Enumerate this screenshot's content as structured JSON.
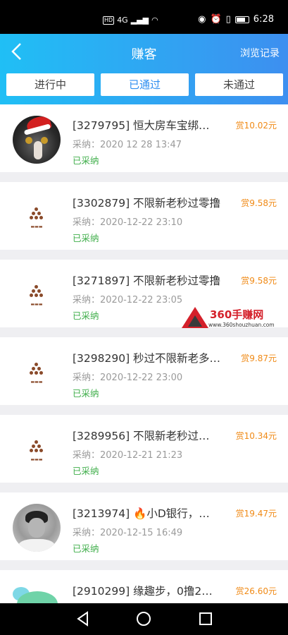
{
  "status_bar": {
    "badge": "HD",
    "network": "4G",
    "time": "6:28"
  },
  "header": {
    "title": "赚客",
    "history_link": "浏览记录",
    "tabs": [
      {
        "label": "进行中",
        "active": false
      },
      {
        "label": "已通过",
        "active": true
      },
      {
        "label": "未通过",
        "active": false
      }
    ]
  },
  "items": [
    {
      "title": "[3279795] 恒大房车宝绑…",
      "reward": "赏10.02元",
      "date": "采纳：2020 12 28 13:47",
      "status": "已采纳",
      "avatar": "cat-christmas-avatar"
    },
    {
      "title": "[3302879] 不限新老秒过零撸",
      "reward": "赏9.58元",
      "date": "采纳：2020-12-22 23:10",
      "status": "已采纳",
      "avatar": "brand-logo-avatar"
    },
    {
      "title": "[3271897] 不限新老秒过零撸",
      "reward": "赏9.58元",
      "date": "采纳：2020-12-22 23:05",
      "status": "已采纳",
      "avatar": "brand-logo-avatar"
    },
    {
      "title": "[3298290] 秒过不限新老多…",
      "reward": "赏9.87元",
      "date": "采纳：2020-12-22 23:00",
      "status": "已采纳",
      "avatar": "brand-logo-avatar"
    },
    {
      "title": "[3289956] 不限新老秒过…",
      "reward": "赏10.34元",
      "date": "采纳：2020-12-21 21:23",
      "status": "已采纳",
      "avatar": "brand-logo-avatar"
    },
    {
      "title": "[3213974] 🔥小D银行，…",
      "reward": "赏19.47元",
      "date": "采纳：2020-12-15 16:49",
      "status": "已采纳",
      "avatar": "person-photo-avatar"
    },
    {
      "title": "[2910299] 缘趣步，0撸2…",
      "reward": "赏26.60元",
      "date": "",
      "status": "",
      "avatar": "mascot-avatar"
    }
  ],
  "watermark": {
    "text": "360手赚网",
    "url": "www.360shouzhuan.com"
  },
  "colors": {
    "header_start": "#20bff5",
    "header_end": "#3d8ff0",
    "reward": "#f08a16",
    "status": "#3fae4a",
    "active_tab": "#2d8ef0"
  }
}
